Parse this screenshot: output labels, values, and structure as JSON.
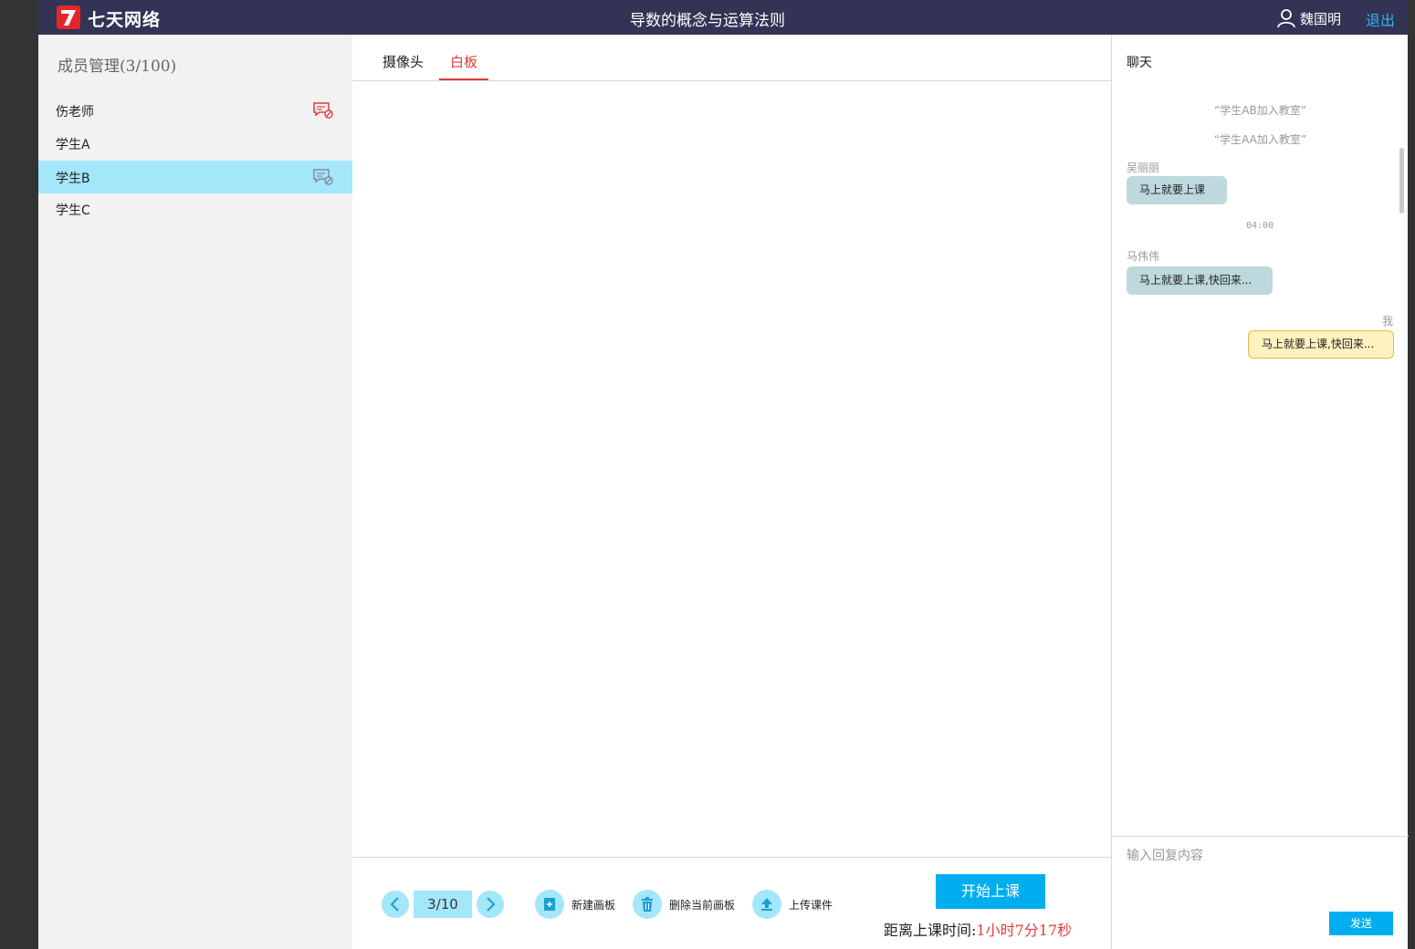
{
  "header": {
    "brand": "七天网络",
    "course_title": "导数的概念与运算法则",
    "user_name": "魏国明",
    "logout_label": "退出"
  },
  "members": {
    "title": "成员管理(3/100)",
    "list": [
      {
        "name": "伤老师",
        "active": false
      },
      {
        "name": "学生A",
        "active": false
      },
      {
        "name": "学生B",
        "active": true
      },
      {
        "name": "学生C",
        "active": false
      }
    ]
  },
  "center": {
    "tabs": [
      {
        "label": "摄像头",
        "active": false
      },
      {
        "label": "白板",
        "active": true
      }
    ],
    "page_indicator": "3/10",
    "tools": {
      "new_board": "新建画板",
      "delete_board": "删除当前画板",
      "upload": "上传课件"
    },
    "start_button": "开始上课",
    "countdown_label": "距离上课时间:",
    "countdown_value": "1小时7分17秒"
  },
  "chat": {
    "title": "聊天",
    "system_messages": [
      "“学生AB加入教室”",
      "“学生AA加入教室”"
    ],
    "messages": [
      {
        "name": "吴丽丽",
        "text": "马上就要上课",
        "time": ""
      },
      {
        "name": "马伟伟",
        "text": "马上就要上课,快回来...",
        "time": "04:00"
      },
      {
        "name": "我",
        "text": "马上就要上课,快回来..."
      }
    ],
    "input_placeholder": "输入回复内容",
    "send_label": "发送"
  },
  "colors": {
    "header_bg": "#333355",
    "panel_bg": "#f2f2f2",
    "active_row": "#a4e6fa",
    "other_bubble": "#bdd9dd",
    "self_bubble": "#fff1c0",
    "accent_blue": "#00aef0",
    "accent_red": "#e23b3b"
  }
}
